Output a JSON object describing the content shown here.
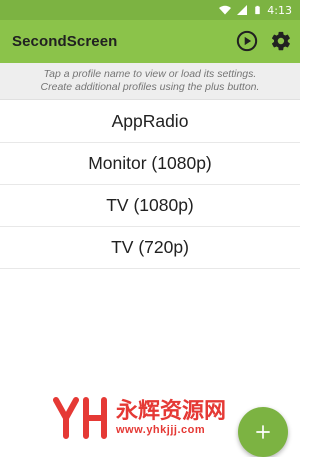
{
  "status_bar": {
    "time": "4:13",
    "icons": [
      "wifi-icon",
      "signal-icon",
      "battery-icon"
    ]
  },
  "app_bar": {
    "title": "SecondScreen",
    "actions": [
      "play-icon",
      "settings-icon"
    ]
  },
  "hint": {
    "line1": "Tap a profile name to view or load its settings.",
    "line2": "Create additional profiles using the plus button."
  },
  "profiles": [
    {
      "label": "AppRadio"
    },
    {
      "label": "Monitor (1080p)"
    },
    {
      "label": "TV (1080p)"
    },
    {
      "label": "TV (720p)"
    }
  ],
  "fab": {
    "icon": "add-icon"
  },
  "watermark": {
    "brand": "永辉资源网",
    "url": "www.yhkjjj.com"
  },
  "colors": {
    "status_bar": "#7cb342",
    "app_bar": "#8bc34a",
    "hint_bg": "#eeeeee",
    "watermark": "#e53935"
  }
}
